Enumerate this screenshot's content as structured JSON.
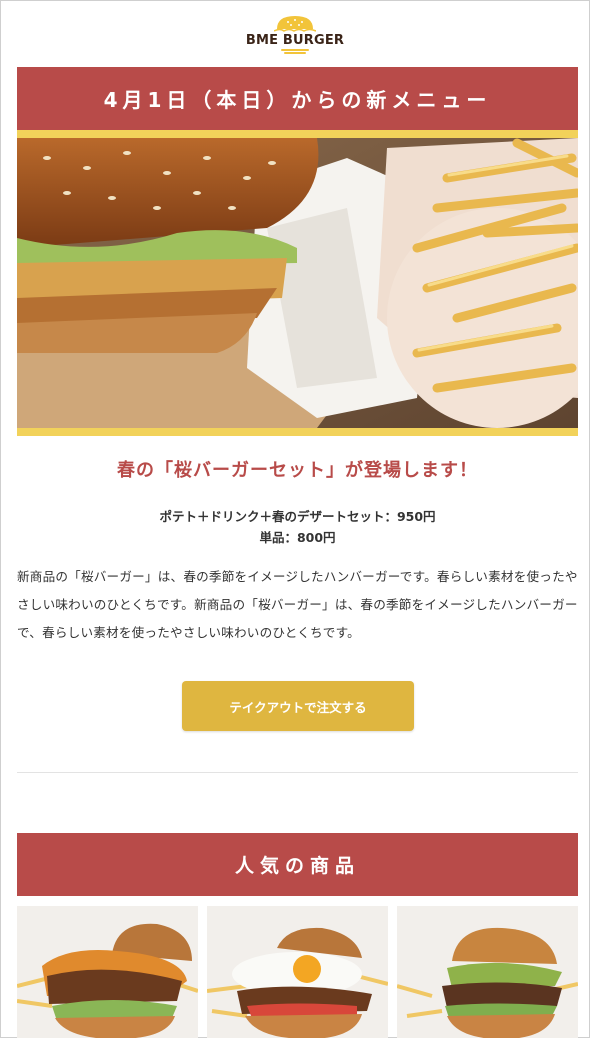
{
  "header": {
    "logo_text": "BME BURGER",
    "logo_icon": "burger-logo-icon"
  },
  "new_menu": {
    "banner_title": "4月1日（本日）からの新メニュー",
    "hero_image": "burger-and-fries-photo",
    "headline": "春の「桜バーガーセット」が登場します！",
    "set_price": "ポテト＋ドリンク＋春のデザートセット：950円",
    "single_price": "単品：800円",
    "description": "新商品の「桜バーガー」は、春の季節をイメージしたハンバーガーです。春らしい素材を使ったやさしい味わいのひとくちです。新商品の「桜バーガー」は、春の季節をイメージしたハンバーガーで、春らしい素材を使ったやさしい味わいのひとくちです。",
    "order_button_label": "テイクアウトで注文する"
  },
  "popular": {
    "banner_title": "人気の商品",
    "products": [
      {
        "image": "cheese-burger-photo"
      },
      {
        "image": "egg-burger-photo"
      },
      {
        "image": "avocado-burger-photo"
      }
    ]
  },
  "colors": {
    "banner_red": "#b84b49",
    "accent_yellow": "#f2d25a",
    "button_gold": "#dfb640",
    "logo_brown": "#3a2418"
  }
}
